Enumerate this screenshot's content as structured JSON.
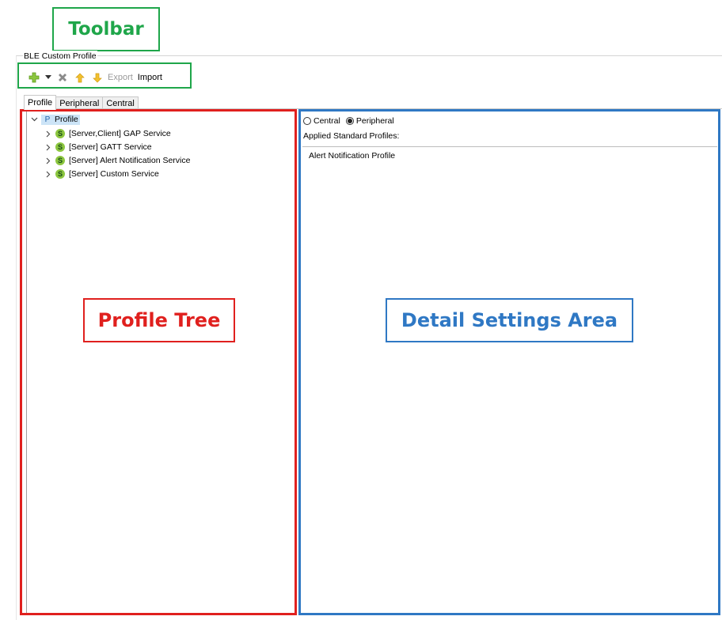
{
  "window": {
    "title": "BLE Custom Profile"
  },
  "toolbar": {
    "items": [
      {
        "icon": "add-icon",
        "color": "#8cc63f"
      },
      {
        "icon": "dropdown-arrow-icon"
      },
      {
        "icon": "delete-icon",
        "color": "#8a8a8a"
      },
      {
        "icon": "move-up-icon",
        "color": "#f2c12e"
      },
      {
        "icon": "move-down-icon",
        "color": "#f2c12e"
      }
    ],
    "export_label": "Export",
    "import_label": "Import"
  },
  "tabs": [
    {
      "label": "Profile",
      "active": true
    },
    {
      "label": "Peripheral",
      "active": false
    },
    {
      "label": "Central",
      "active": false
    }
  ],
  "tree": {
    "root": {
      "badge": "P",
      "label": "Profile",
      "expanded": true
    },
    "services": [
      {
        "badge": "S",
        "label": "[Server,Client] GAP Service"
      },
      {
        "badge": "S",
        "label": "[Server] GATT Service"
      },
      {
        "badge": "S",
        "label": "[Server] Alert Notification Service"
      },
      {
        "badge": "S",
        "label": "[Server] Custom Service"
      }
    ]
  },
  "detail": {
    "role_options": [
      {
        "label": "Central",
        "selected": false
      },
      {
        "label": "Peripheral",
        "selected": true
      }
    ],
    "applied_label": "Applied Standard Profiles:",
    "applied_profiles": [
      "Alert Notification Profile"
    ]
  },
  "annotations": {
    "toolbar": {
      "label": "Toolbar",
      "color": "#1fa64a"
    },
    "profile_tree": {
      "label": "Profile Tree",
      "color": "#e0201e"
    },
    "detail_area": {
      "label": "Detail Settings Area",
      "color": "#2f78c4"
    }
  }
}
